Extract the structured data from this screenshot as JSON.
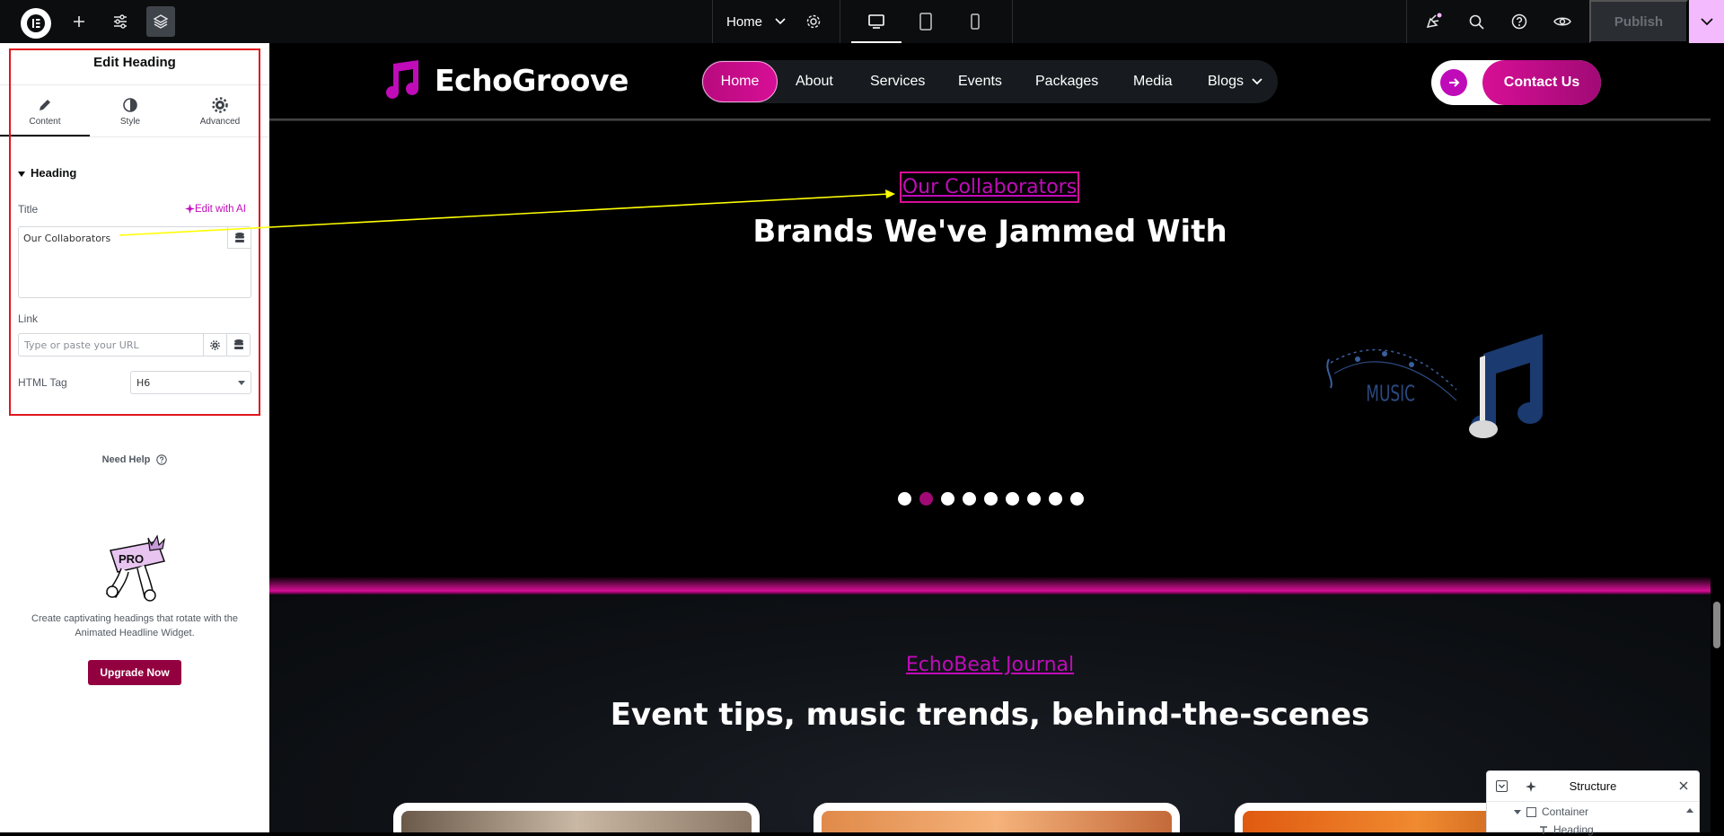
{
  "topbar": {
    "page_name": "Home",
    "publish_label": "Publish",
    "icons": [
      "elementor-logo-icon",
      "add-icon",
      "settings-sliders-icon",
      "layers-icon",
      "chevron-down-icon",
      "gear-icon",
      "desktop-icon",
      "tablet-icon",
      "mobile-icon",
      "notifications-icon",
      "search-icon",
      "help-icon",
      "preview-eye-icon",
      "chevron-down-icon"
    ]
  },
  "panel": {
    "title": "Edit Heading",
    "tabs": [
      {
        "label": "Content",
        "icon": "pencil-icon"
      },
      {
        "label": "Style",
        "icon": "contrast-icon"
      },
      {
        "label": "Advanced",
        "icon": "gear-icon"
      }
    ],
    "section": "Heading",
    "title_label": "Title",
    "edit_ai_label": "Edit with AI",
    "title_value": "Our Collaborators",
    "link_label": "Link",
    "link_placeholder": "Type or paste your URL",
    "html_tag_label": "HTML Tag",
    "html_tag_value": "H6",
    "need_help": "Need Help",
    "promo_badge": "PRO",
    "promo_text": "Create captivating headings that rotate with the Animated Headline Widget.",
    "upgrade_label": "Upgrade Now"
  },
  "site": {
    "brand": "EchoGroove",
    "nav": [
      "Home",
      "About",
      "Services",
      "Events",
      "Packages",
      "Media",
      "Blogs"
    ],
    "active_nav": "Home",
    "cta": "Contact Us",
    "collab_sub": "Our Collaborators",
    "collab_title": "Brands We've Jammed With",
    "logo_text": "MUSIC",
    "carousel_dots": 9,
    "active_dot": 2,
    "journal_sub": "EchoBeat Journal",
    "journal_title": "Event tips, music trends, behind-the-scenes"
  },
  "structure": {
    "title": "Structure",
    "rows": [
      "Container",
      "Heading"
    ]
  },
  "colors": {
    "accent": "#d70f96",
    "accent_dark": "#a10a75",
    "editor_dark": "#0c0d0e",
    "upgrade": "#93003f",
    "highlight_border": "#e0161e",
    "annotation": "#ffff00"
  }
}
